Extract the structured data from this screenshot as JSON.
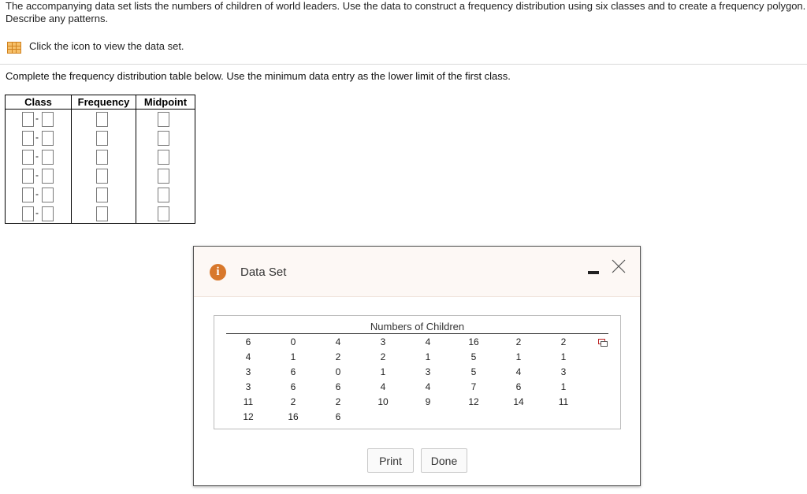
{
  "question": {
    "text": "The accompanying data set lists the numbers of children of world leaders. Use the data to construct a frequency distribution using six classes and to create a frequency polygon. Describe any patterns."
  },
  "data_link": {
    "icon": "table-grid-icon",
    "label": "Click the icon to view the data set."
  },
  "instruction": "Complete the frequency distribution table below. Use the minimum data entry as the lower limit of the first class.",
  "table": {
    "headers": [
      "Class",
      "Frequency",
      "Midpoint"
    ],
    "rows": 6,
    "class_separator": "-"
  },
  "dialog": {
    "title": "Data Set",
    "info_icon": "i",
    "dataset_title": "Numbers of Children",
    "columns": [
      [
        "6",
        "4",
        "3",
        "3",
        "11",
        "12"
      ],
      [
        "0",
        "1",
        "6",
        "6",
        "2",
        "16"
      ],
      [
        "4",
        "2",
        "0",
        "6",
        "2",
        "6"
      ],
      [
        "3",
        "2",
        "1",
        "4",
        "10"
      ],
      [
        "4",
        "1",
        "3",
        "4",
        "9"
      ],
      [
        "16",
        "5",
        "5",
        "7",
        "12"
      ],
      [
        "2",
        "1",
        "4",
        "6",
        "14"
      ],
      [
        "2",
        "1",
        "3",
        "1",
        "11"
      ]
    ],
    "print_label": "Print",
    "done_label": "Done"
  },
  "colors": {
    "accent_orange": "#d8782c",
    "icon_fill": "#f6c06a"
  }
}
